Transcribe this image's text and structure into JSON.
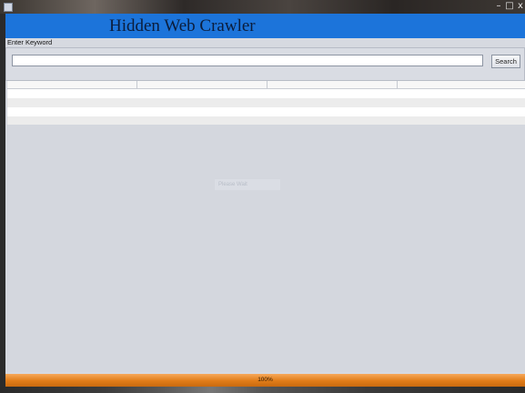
{
  "window": {
    "controls": {
      "minimize": "–",
      "maximize": "□",
      "close": "x"
    }
  },
  "banner": {
    "title": "Hidden Web Crawler"
  },
  "search": {
    "label": "Enter Keyword",
    "value": "",
    "placeholder": "",
    "button_label": "Search"
  },
  "results_table": {
    "columns": [
      "",
      "",
      "",
      ""
    ],
    "rows": []
  },
  "overlay_text": "Please Wait",
  "progress": {
    "label": "100%",
    "value": 1.0
  },
  "colors": {
    "banner": "#1c74da",
    "progress": "#e07c18",
    "panel": "#d6d9e0"
  }
}
